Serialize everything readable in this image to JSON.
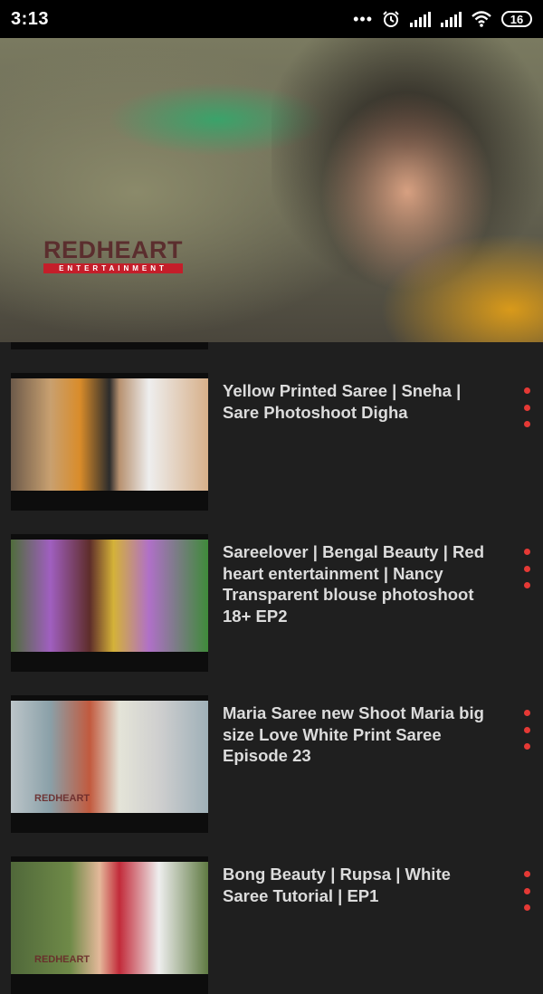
{
  "status_bar": {
    "time": "3:13",
    "battery_level": "16",
    "icons": [
      "more-dots-icon",
      "alarm-icon",
      "signal-icon",
      "signal-icon",
      "wifi-icon",
      "battery-icon"
    ]
  },
  "hero": {
    "brand_top": "REDHEART",
    "brand_bottom": "ENTERTAINMENT"
  },
  "videos": [
    {
      "title": "Yellow Printed Saree | Sneha | Sare Photoshoot Digha",
      "watermark": ""
    },
    {
      "title": "Sareelover | Bengal Beauty | Red heart entertainment | Nancy Transparent blouse photoshoot 18+ EP2",
      "watermark": ""
    },
    {
      "title": "Maria Saree new Shoot Maria big size Love White Print Saree Episode 23",
      "watermark": "REDHEART"
    },
    {
      "title": "Bong Beauty | Rupsa | White Saree Tutorial | EP1",
      "watermark": "REDHEART"
    }
  ],
  "colors": {
    "background": "#1f1f1f",
    "accent_dots": "#e53935",
    "brand_red": "#c41e2a"
  }
}
